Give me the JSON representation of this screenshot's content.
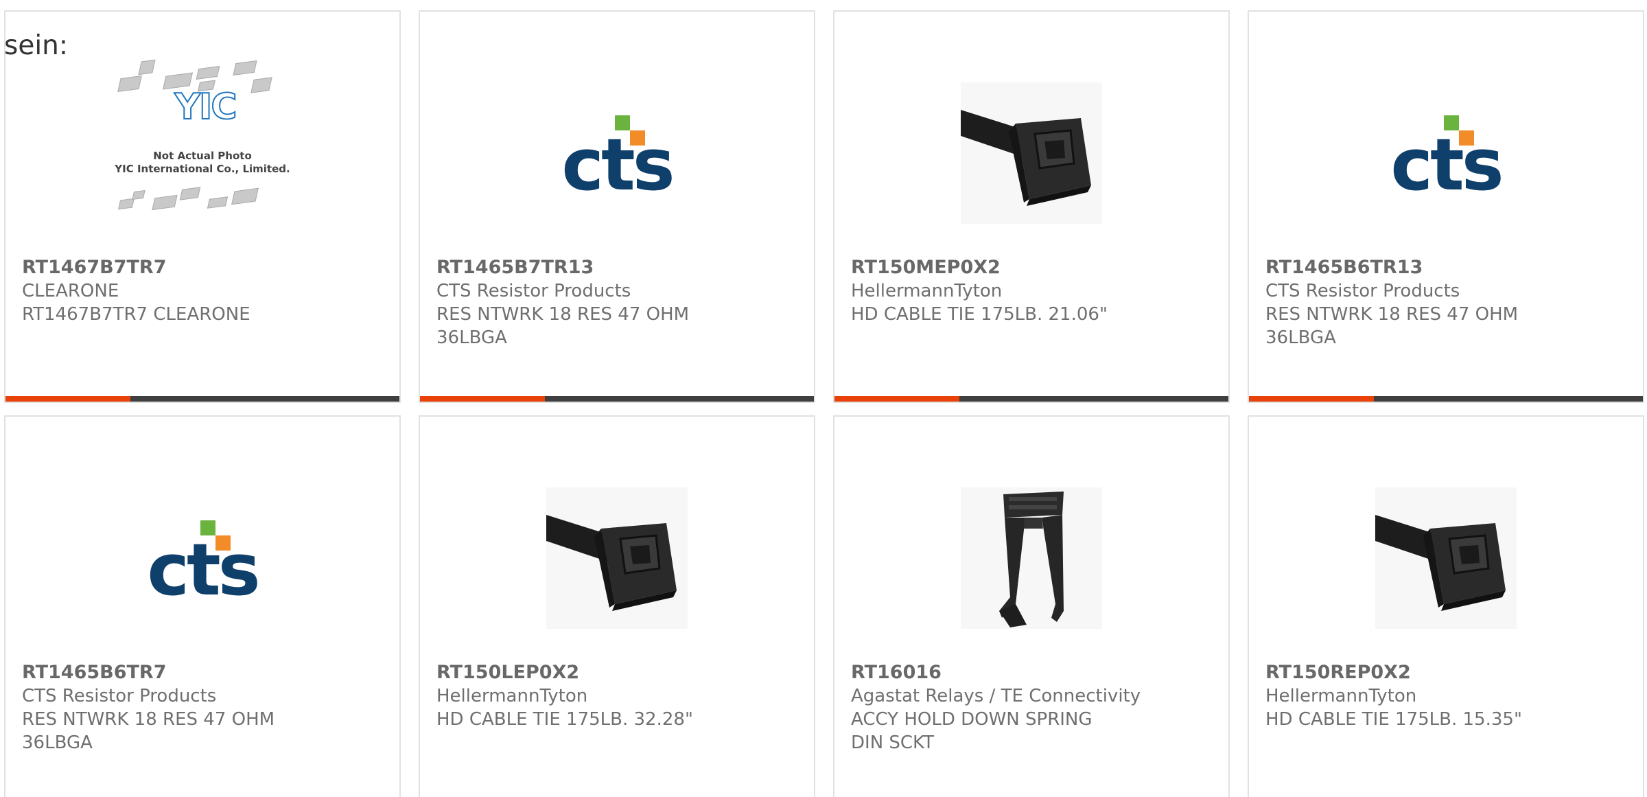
{
  "intro_text": "sein:",
  "colors": {
    "accent": "#e8410a",
    "bar": "#3f3f3f",
    "cts_blue": "#0f3f6b",
    "cts_green": "#6ab33e",
    "cts_orange": "#f28c28"
  },
  "placeholder": {
    "line1": "Not Actual Photo",
    "line2": "YIC International Co., Limited.",
    "logo": "YIC"
  },
  "products": [
    {
      "part": "RT1467B7TR7",
      "maker": "CLEARONE",
      "desc": "RT1467B7TR7 CLEARONE",
      "image": "yic-placeholder"
    },
    {
      "part": "RT1465B7TR13",
      "maker": "CTS Resistor Products",
      "desc": "RES NTWRK 18 RES 47 OHM 36LBGA",
      "image": "cts-logo"
    },
    {
      "part": "RT150MEP0X2",
      "maker": "HellermannTyton",
      "desc": "HD CABLE TIE 175LB. 21.06\"",
      "image": "cable-tie"
    },
    {
      "part": "RT1465B6TR13",
      "maker": "CTS Resistor Products",
      "desc": "RES NTWRK 18 RES 47 OHM 36LBGA",
      "image": "cts-logo"
    },
    {
      "part": "RT1465B6TR7",
      "maker": "CTS Resistor Products",
      "desc": "RES NTWRK 18 RES 47 OHM 36LBGA",
      "image": "cts-logo"
    },
    {
      "part": "RT150LEP0X2",
      "maker": "HellermannTyton",
      "desc": "HD CABLE TIE 175LB. 32.28\"",
      "image": "cable-tie"
    },
    {
      "part": "RT16016",
      "maker": "Agastat Relays / TE Connectivity",
      "desc": "ACCY HOLD DOWN SPRING DIN SCKT",
      "image": "spring-clip"
    },
    {
      "part": "RT150REP0X2",
      "maker": "HellermannTyton",
      "desc": "HD CABLE TIE 175LB. 15.35\"",
      "image": "cable-tie"
    }
  ]
}
